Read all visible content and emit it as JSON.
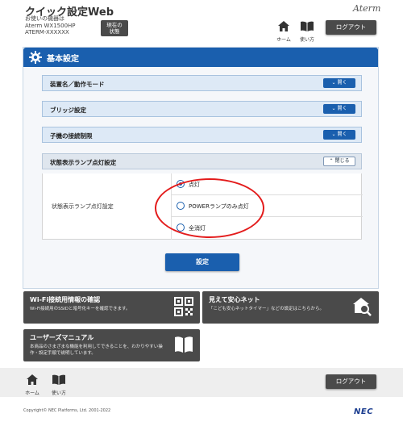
{
  "header": {
    "app_title": "クイック設定Web",
    "device_line1": "お使いの機器は",
    "device_line2": "Aterm WX1500HP",
    "device_line3": "ATERM-XXXXXX",
    "status_button": "現在の\n状態",
    "brand": "Aterm",
    "home_label": "ホーム",
    "guide_label": "使い方",
    "logout_label": "ログアウト"
  },
  "panel": {
    "title": "基本設定",
    "sections": [
      {
        "label": "装置名／動作モード",
        "button": "開く"
      },
      {
        "label": "ブリッジ設定",
        "button": "開く"
      },
      {
        "label": "子機の接続制限",
        "button": "開く"
      },
      {
        "label": "状態表示ランプ点灯設定",
        "button": "閉じる"
      }
    ],
    "lamp_setting": {
      "label": "状態表示ランプ点灯設定",
      "options": [
        {
          "label": "点灯",
          "selected": true
        },
        {
          "label": "POWERランプのみ点灯",
          "selected": false
        },
        {
          "label": "全消灯",
          "selected": false
        }
      ]
    },
    "apply_button": "設定"
  },
  "tiles": [
    {
      "title": "Wi-Fi接続用情報の確認",
      "desc": "Wi-Fi接続用のSSIDと暗号化キーを確認できます。",
      "icon": "qr-code-icon"
    },
    {
      "title": "見えて安心ネット",
      "desc": "「こども安心ネットタイマー」などの設定はこちらから。",
      "icon": "home-search-icon"
    },
    {
      "title": "ユーザーズマニュアル",
      "desc": "本商品のさまざまな機能を利用してできることを、わかりやすい操作・設定手順で説明しています。",
      "icon": "book-icon"
    }
  ],
  "footer": {
    "home_label": "ホーム",
    "guide_label": "使い方",
    "logout_label": "ログアウト",
    "copyright": "Copyright© NEC Platforms, Ltd. 2001-2022",
    "brand": "NEC"
  },
  "colors": {
    "accent": "#1a5fae",
    "dark_button": "#4a4a4a",
    "highlight_ring": "#e31b1b"
  }
}
